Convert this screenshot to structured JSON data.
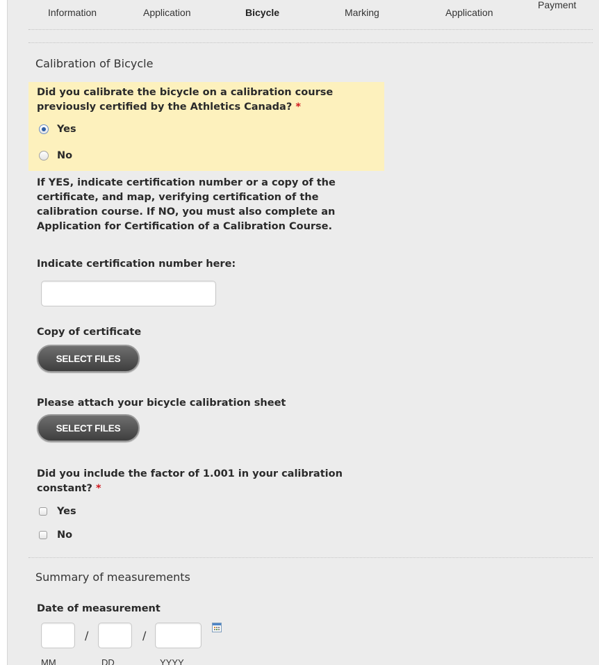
{
  "steps": [
    {
      "label": "Information"
    },
    {
      "label": "Application"
    },
    {
      "label": "Bicycle"
    },
    {
      "label": "Marking"
    },
    {
      "label": "Application"
    },
    {
      "label": "Payment"
    }
  ],
  "calibration_section": {
    "title": "Calibration of Bicycle",
    "question1": {
      "text": "Did you calibrate the bicycle on a calibration course previously certified by the Athletics Canada?",
      "required_mark": "*",
      "options": [
        {
          "label": "Yes",
          "selected": true
        },
        {
          "label": "No",
          "selected": false
        }
      ]
    },
    "instructions": "If YES, indicate certification number or a copy of the certificate, and map, verifying certification of the calibration course. If NO, you must also complete an Application for Certification of a Calibration Course.",
    "cert_number_label": "Indicate certification number here:",
    "cert_number_value": "",
    "copy_label": "Copy of certificate",
    "copy_button": "SELECT FILES",
    "sheet_label": "Please attach your bicycle calibration sheet",
    "sheet_button": "SELECT FILES",
    "question2": {
      "text": "Did you include the factor of 1.001 in your calibration constant?",
      "required_mark": "*",
      "options": [
        {
          "label": "Yes",
          "checked": false
        },
        {
          "label": "No",
          "checked": false
        }
      ]
    }
  },
  "summary_section": {
    "title": "Summary of measurements",
    "date_label": "Date of measurement",
    "separator": "/",
    "mm_label": "MM",
    "dd_label": "DD",
    "yyyy_label": "YYYY",
    "icon": "calendar-icon"
  },
  "colors": {
    "highlight": "#fdf1bd",
    "required": "#d0191f",
    "radio_selected": "#2f5fa4",
    "panel_bg": "#ececec"
  }
}
